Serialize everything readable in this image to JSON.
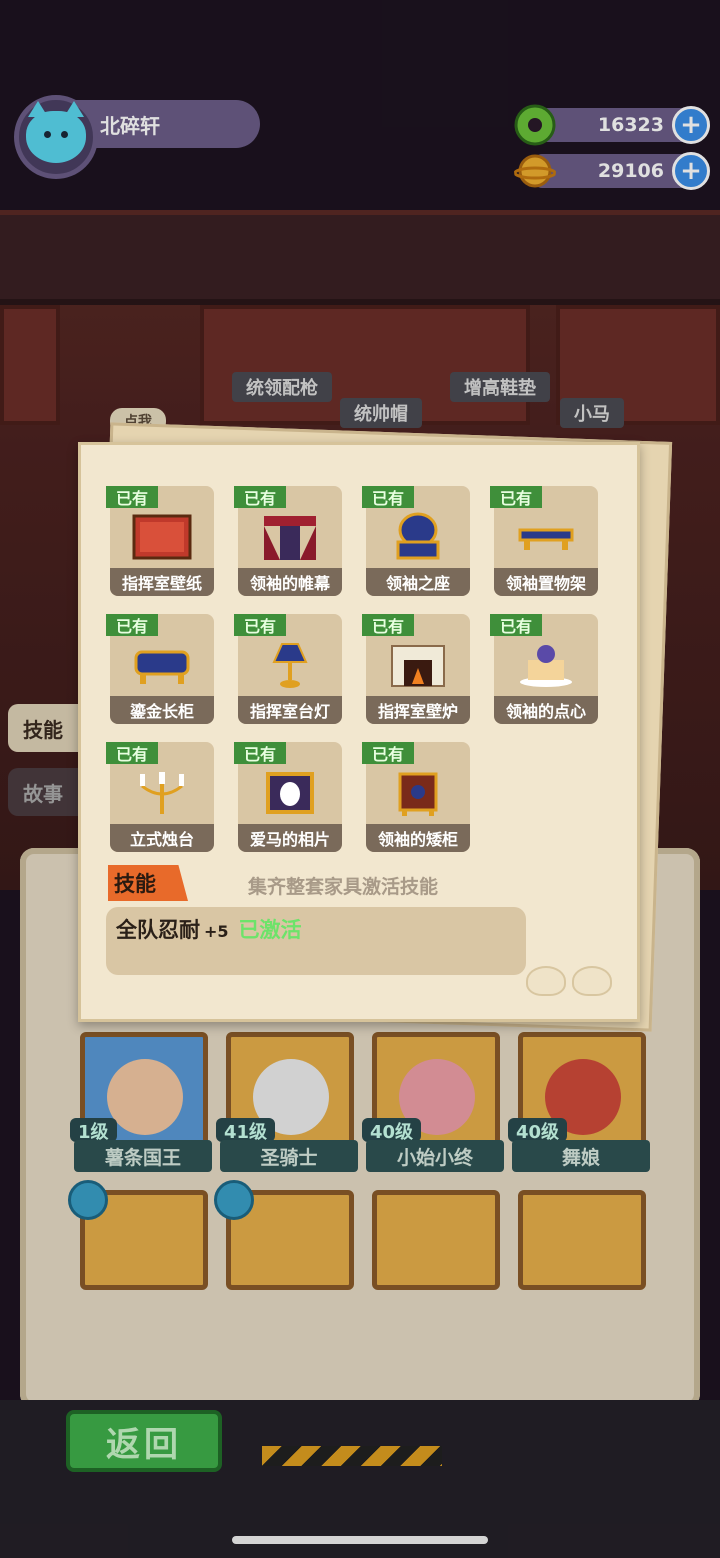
{
  "player": {
    "name": "北碎轩"
  },
  "currency": [
    {
      "name": "green-donut",
      "amount": "16323",
      "plus": "+"
    },
    {
      "name": "gold-planet",
      "amount": "29106",
      "plus": "+"
    }
  ],
  "shelf_labels": [
    "统领配枪",
    "统帅帽",
    "增高鞋垫",
    "小马"
  ],
  "click_hint": "点我",
  "side_tabs": [
    "技能",
    "故事"
  ],
  "set_items": [
    {
      "status": "已有",
      "name": "指挥室壁纸",
      "icon": "wallpaper-icon"
    },
    {
      "status": "已有",
      "name": "领袖的帷幕",
      "icon": "curtain-icon"
    },
    {
      "status": "已有",
      "name": "领袖之座",
      "icon": "throne-icon"
    },
    {
      "status": "已有",
      "name": "领袖置物架",
      "icon": "shelf-icon"
    },
    {
      "status": "已有",
      "name": "鎏金长柜",
      "icon": "cabinet-icon"
    },
    {
      "status": "已有",
      "name": "指挥室台灯",
      "icon": "lamp-icon"
    },
    {
      "status": "已有",
      "name": "指挥室壁炉",
      "icon": "fireplace-icon"
    },
    {
      "status": "已有",
      "name": "领袖的点心",
      "icon": "cake-icon"
    },
    {
      "status": "已有",
      "name": "立式烛台",
      "icon": "candelabra-icon"
    },
    {
      "status": "已有",
      "name": "爱马的相片",
      "icon": "horse-photo-icon"
    },
    {
      "status": "已有",
      "name": "领袖的矮柜",
      "icon": "low-cabinet-icon"
    }
  ],
  "skill": {
    "tag": "技能",
    "hint": "集齐整套家具激活技能",
    "effect": "全队忍耐",
    "bonus": "+5",
    "status": "已激活"
  },
  "heroes": [
    {
      "level": "1级",
      "name": "薯条国王"
    },
    {
      "level": "41级",
      "name": "圣骑士"
    },
    {
      "level": "40级",
      "name": "小始小终"
    },
    {
      "level": "40级",
      "name": "舞娘"
    }
  ],
  "back_button": "返回",
  "colors": {
    "owned_tag": "#3f8f3a",
    "skill_tag": "#e86a2a",
    "activated": "#6de36a",
    "back_button": "#3fb04a"
  }
}
